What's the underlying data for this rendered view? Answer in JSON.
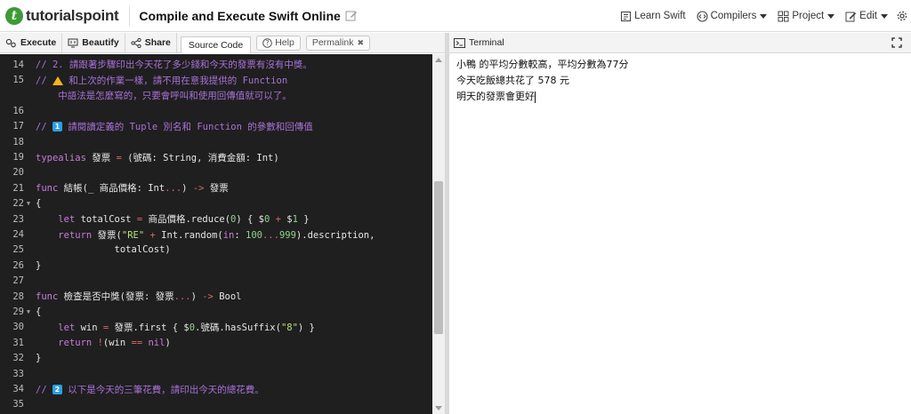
{
  "header": {
    "logo_text": "tutorialspoint",
    "title": "Compile and Execute Swift Online",
    "links": [
      {
        "label": "Learn Swift",
        "icon": "book-icon"
      },
      {
        "label": "Compilers",
        "icon": "code-icon",
        "dropdown": true
      },
      {
        "label": "Project",
        "icon": "grid-icon",
        "dropdown": true
      },
      {
        "label": "Edit",
        "icon": "pencil-icon",
        "dropdown": true
      }
    ]
  },
  "toolbar": {
    "execute_label": "Execute",
    "beautify_label": "Beautify",
    "share_label": "Share",
    "source_tab_label": "Source Code",
    "help_label": "Help",
    "permalink_label": "Permalink"
  },
  "terminal": {
    "title": "Terminal",
    "lines": [
      "小鴨 的平均分數較高，平均分數為77分",
      "今天吃飯總共花了 578 元",
      "明天的發票會更好"
    ]
  },
  "code_lines": [
    {
      "n": "14",
      "text": "// 2. 請跟著步驟印出今天花了多少錢和今天的發票有沒有中獎。"
    },
    {
      "n": "15",
      "text": "//  ⚠  和上次的作業一樣，請不用在意我提供的 Function"
    },
    {
      "n": "",
      "text": "    中語法是怎麼寫的，只要會呼叫和使用回傳值就可以了。"
    },
    {
      "n": "16",
      "text": ""
    },
    {
      "n": "17",
      "text": "// 1 請閱讀定義的 Tuple 別名和 Function 的參數和回傳值"
    },
    {
      "n": "18",
      "text": ""
    },
    {
      "n": "19",
      "text": "typealias 發票 = (號碼: String, 消費金額: Int)"
    },
    {
      "n": "20",
      "text": ""
    },
    {
      "n": "21",
      "text": "func 結帳(_ 商品價格: Int...) -> 發票"
    },
    {
      "n": "22",
      "text": "{"
    },
    {
      "n": "23",
      "text": "    let totalCost = 商品價格.reduce(0) { $0 + $1 }"
    },
    {
      "n": "24",
      "text": "    return 發票(\"RE\" + Int.random(in: 100...999).description,"
    },
    {
      "n": "25",
      "text": "              totalCost)"
    },
    {
      "n": "26",
      "text": "}"
    },
    {
      "n": "27",
      "text": ""
    },
    {
      "n": "28",
      "text": "func 檢查是否中獎(發票: 發票...) -> Bool"
    },
    {
      "n": "29",
      "text": "{"
    },
    {
      "n": "30",
      "text": "    let win = 發票.first { $0.號碼.hasSuffix(\"8\") }"
    },
    {
      "n": "31",
      "text": "    return !(win == nil)"
    },
    {
      "n": "32",
      "text": "}"
    },
    {
      "n": "33",
      "text": ""
    },
    {
      "n": "34",
      "text": "// 2 以下是今天的三筆花費，請印出今天的總花費。"
    },
    {
      "n": "35",
      "text": ""
    }
  ]
}
